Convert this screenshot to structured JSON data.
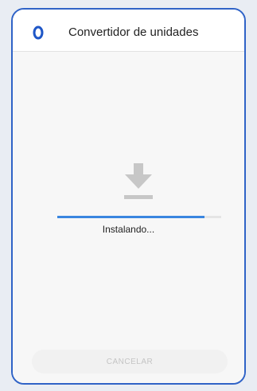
{
  "header": {
    "title": "Convertidor de unidades",
    "icon": "app-logo-icon",
    "icon_color": "#1f57c7"
  },
  "install": {
    "icon": "download-icon",
    "icon_color": "#c7c7c7",
    "progress_percent": 90,
    "progress_color": "#3a86e0",
    "status": "Instalando..."
  },
  "footer": {
    "cancel_label": "CANCELAR"
  },
  "frame_color": "#2f63c7"
}
